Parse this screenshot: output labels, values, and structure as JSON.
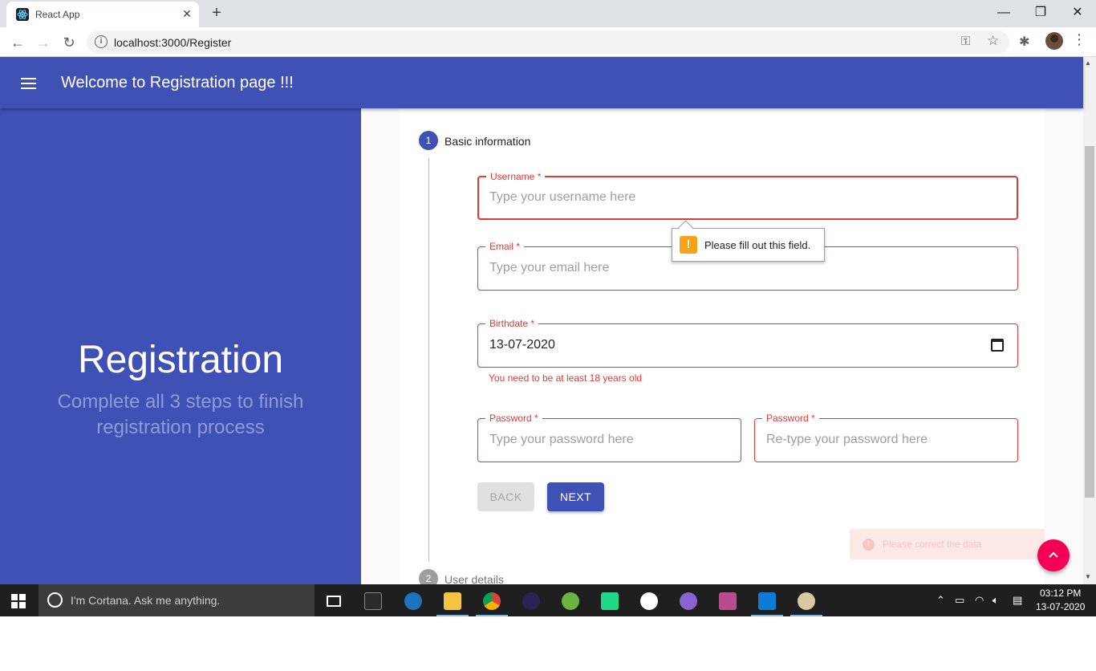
{
  "browser": {
    "tab_title": "React App",
    "tab_close": "✕",
    "new_tab": "+",
    "url": "localhost:3000/Register",
    "window_controls": {
      "minimize": "—",
      "restore": "❐",
      "close": "✕"
    }
  },
  "appbar": {
    "title": "Welcome to Registration page !!!"
  },
  "hero": {
    "title": "Registration",
    "subtitle": "Complete all 3 steps to finish registration process"
  },
  "stepper": {
    "steps": [
      {
        "number": "1",
        "label": "Basic information",
        "active": true
      },
      {
        "number": "2",
        "label": "User details",
        "active": false
      }
    ]
  },
  "form": {
    "username": {
      "label": "Username *",
      "placeholder": "Type your username here",
      "value": ""
    },
    "email": {
      "label": "Email *",
      "placeholder": "Type your email here",
      "value": ""
    },
    "birthdate": {
      "label": "Birthdate *",
      "value": "13-07-2020",
      "helper": "You need to be at least 18 years old"
    },
    "password": {
      "label": "Password *",
      "placeholder": "Type your password here",
      "value": ""
    },
    "password_confirm": {
      "label": "Password *",
      "placeholder": "Re-type your password here",
      "value": ""
    }
  },
  "buttons": {
    "back": "BACK",
    "next": "NEXT"
  },
  "tooltip": {
    "icon": "!",
    "text": "Please fill out this field."
  },
  "snackbar": {
    "icon": "!",
    "text": "Please correct the data"
  },
  "taskbar": {
    "search_placeholder": "I'm Cortana. Ask me anything.",
    "time": "03:12 PM",
    "date": "13-07-2020"
  },
  "colors": {
    "primary": "#3f51b5",
    "error": "#e53935",
    "accent": "#f50057",
    "warning": "#f7a21b"
  }
}
